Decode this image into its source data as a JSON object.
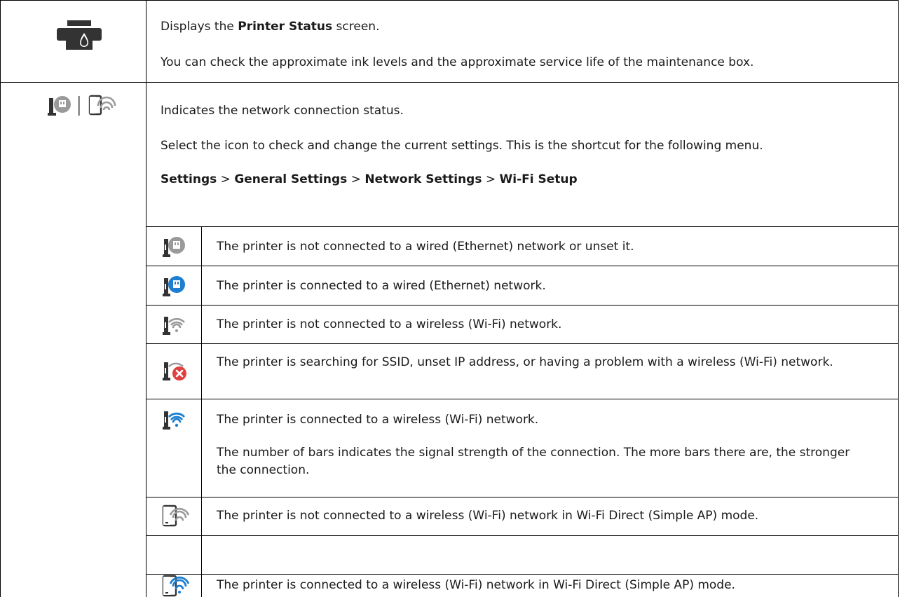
{
  "rows": [
    {
      "icon": "printer-ink-icon",
      "lines": [
        {
          "pre": "Displays the ",
          "bold": "Printer Status",
          "post": " screen."
        },
        {
          "text": "You can check the approximate ink levels and the approximate service life of the maintenance box."
        }
      ]
    },
    {
      "icon": "network-status-icons",
      "lines": [
        {
          "text": "Indicates the network connection status."
        },
        {
          "text": "Select the icon to check and change the current settings. This is the shortcut for the following menu."
        }
      ],
      "menu_path": {
        "items": [
          "Settings",
          "General Settings",
          "Network Settings",
          "Wi-Fi Setup"
        ],
        "separator": " > "
      },
      "subrows": [
        {
          "icon": "wired-disconnected-icon",
          "text": "The printer is not connected to a wired (Ethernet) network or unset it."
        },
        {
          "icon": "wired-connected-icon",
          "text": "The printer is connected to a wired (Ethernet) network."
        },
        {
          "icon": "wifi-disconnected-icon",
          "text": "The printer is not connected to a wireless (Wi-Fi) network."
        },
        {
          "icon": "wifi-error-icon",
          "text": "The printer is searching for SSID, unset IP address, or having a problem with a wireless (Wi-Fi) network."
        },
        {
          "icon": "wifi-connected-icon",
          "text": "The printer is connected to a wireless (Wi-Fi) network.",
          "note": "The number of bars indicates the signal strength of the connection. The more bars there are, the stronger the connection."
        },
        {
          "icon": "wifi-direct-disconnected-icon",
          "text": "The printer is not connected to a wireless (Wi-Fi) network in Wi-Fi Direct (Simple AP) mode."
        },
        {
          "icon": "wifi-direct-connected-icon",
          "text": "The printer is connected to a wireless (Wi-Fi) network in Wi-Fi Direct (Simple AP) mode."
        }
      ]
    }
  ],
  "colors": {
    "border": "#000000",
    "accent_blue": "#1e7fd0",
    "error_red": "#e04040",
    "icon_gray": "#9a9a9a",
    "icon_dark": "#333333"
  }
}
